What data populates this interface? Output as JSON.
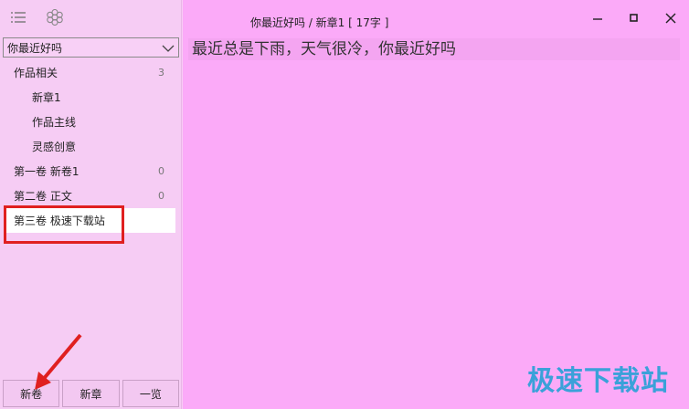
{
  "sidebar": {
    "book_select": "你最近好吗",
    "tree": [
      {
        "label": "作品相关",
        "count": "3",
        "level": 0
      },
      {
        "label": "新章1",
        "count": "",
        "level": 1
      },
      {
        "label": "作品主线",
        "count": "",
        "level": 1
      },
      {
        "label": "灵感创意",
        "count": "",
        "level": 1
      },
      {
        "label": "第一卷 新卷1",
        "count": "0",
        "level": 0
      },
      {
        "label": "第二卷 正文",
        "count": "0",
        "level": 0
      },
      {
        "label": "第三卷 极速下载站",
        "count": "",
        "level": 0
      }
    ],
    "bottom_buttons": {
      "new_volume": "新卷",
      "new_chapter": "新章",
      "overview": "一览"
    }
  },
  "main": {
    "title": "你最近好吗 / 新章1 [ 17字 ]",
    "editor_text": "最近总是下雨，天气很冷，你最近好吗"
  },
  "watermark": "极速下载站",
  "colors": {
    "sidebar_bg": "#f6ccf4",
    "main_bg": "#fbaaf8",
    "annotation_red": "#e02020",
    "watermark_blue": "#3aa1d9"
  }
}
